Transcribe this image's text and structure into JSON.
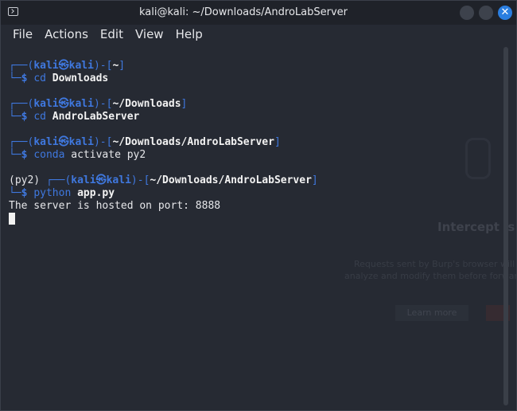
{
  "window": {
    "title": "kali@kali: ~/Downloads/AndroLabServer",
    "close_label": "✕"
  },
  "menu": [
    "File",
    "Actions",
    "Edit",
    "View",
    "Help"
  ],
  "terminal": {
    "p1": {
      "path": "~",
      "cmd": "cd",
      "arg": "Downloads"
    },
    "p2": {
      "path": "~/Downloads",
      "cmd": "cd",
      "arg": "AndroLabServer"
    },
    "p3": {
      "path": "~/Downloads/AndroLabServer",
      "cmd": "conda",
      "arg": "activate py2"
    },
    "p4": {
      "env": "(py2) ",
      "path": "~/Downloads/AndroLabServer",
      "cmd": "python",
      "arg": "app.py"
    },
    "output": "The server is hosted on port: 8888",
    "user": "kali",
    "at": "㉿",
    "host": "kali"
  },
  "background": {
    "title": "Intercept is o",
    "line1": "Requests sent by Burp's browser will be",
    "line2": "analyze and modify them before forwardi",
    "button": "Learn more"
  }
}
